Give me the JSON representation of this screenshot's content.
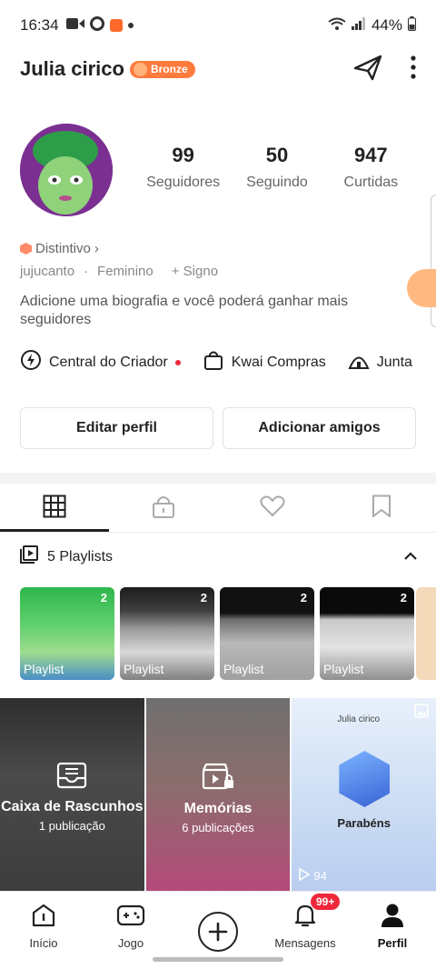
{
  "status": {
    "time": "16:34",
    "battery": "44%"
  },
  "header": {
    "name": "Julia cirico",
    "badge": "Bronze"
  },
  "stats": [
    {
      "value": "99",
      "label": "Seguidores"
    },
    {
      "value": "50",
      "label": "Seguindo"
    },
    {
      "value": "947",
      "label": "Curtidas"
    }
  ],
  "profile": {
    "distintivo": "Distintivo",
    "username": "jujucanto",
    "gender": "Feminino",
    "sign": "+ Signo",
    "bio": "Adicione uma biografia e você poderá ganhar mais seguidores"
  },
  "shortcuts": [
    "Central do Criador",
    "Kwai Compras",
    "Junta"
  ],
  "buttons": {
    "edit": "Editar perfil",
    "add_friends": "Adicionar amigos"
  },
  "playlists": {
    "header": "5 Playlists",
    "items": [
      {
        "label": "Playlist",
        "count": "2"
      },
      {
        "label": "Playlist",
        "count": "2"
      },
      {
        "label": "Playlist",
        "count": "2"
      },
      {
        "label": "Playlist",
        "count": "2"
      }
    ]
  },
  "grid": [
    {
      "title": "Caixa de Rascunhos",
      "subtitle": "1 publicação"
    },
    {
      "title": "Memórias",
      "subtitle": "6 publicações"
    },
    {
      "name": "Julia cirico",
      "title": "Parabéns",
      "views": "94"
    }
  ],
  "nav": {
    "items": [
      "Início",
      "Jogo",
      "Mensagens",
      "Perfil"
    ],
    "badge": "99+"
  }
}
